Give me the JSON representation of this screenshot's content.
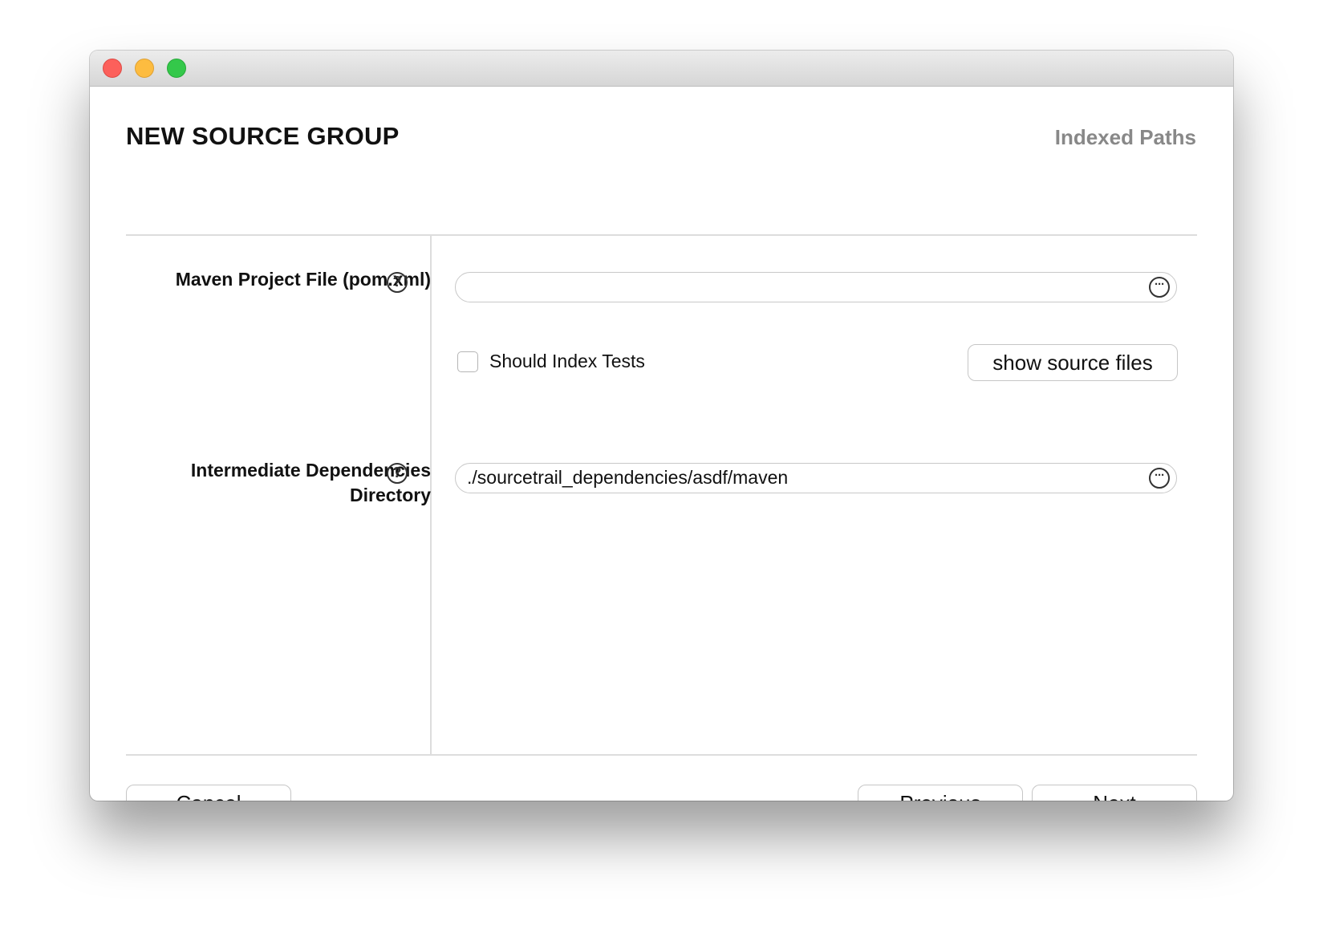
{
  "window": {
    "controls": {
      "close_icon": "close-icon",
      "minimize_icon": "minimize-icon",
      "zoom_icon": "zoom-icon",
      "colors": {
        "close": "#fc605b",
        "minimize": "#fdbc40",
        "zoom": "#34c84a"
      }
    }
  },
  "header": {
    "title": "NEW SOURCE GROUP",
    "step": "Indexed Paths"
  },
  "form": {
    "maven_project_file": {
      "label": "Maven Project File (pom.xml)",
      "value": "",
      "help_icon": "question-mark-icon",
      "browse_icon": "ellipsis-icon"
    },
    "should_index_tests": {
      "label": "Should Index Tests",
      "checked": false
    },
    "show_source_files_label": "show source files",
    "intermediate_dependencies_directory": {
      "label": "Intermediate Dependencies Directory",
      "value": "./sourcetrail_dependencies/asdf/maven",
      "help_icon": "question-mark-icon",
      "browse_icon": "ellipsis-icon"
    }
  },
  "footer": {
    "cancel_label": "Cancel",
    "previous_label": "Previous",
    "next_label": "Next"
  }
}
